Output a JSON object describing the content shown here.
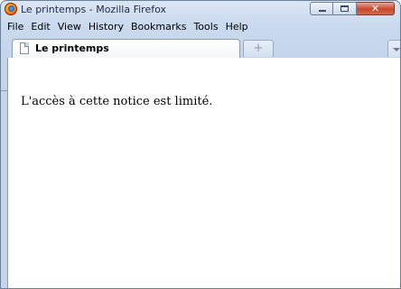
{
  "window": {
    "title": "Le printemps - Mozilla Firefox",
    "close_glyph": "✕"
  },
  "menu": {
    "items": [
      "File",
      "Edit",
      "View",
      "History",
      "Bookmarks",
      "Tools",
      "Help"
    ]
  },
  "tabs": {
    "active_label": "Le printemps",
    "new_tab_glyph": "+"
  },
  "page": {
    "text": "L'accès à cette notice est limité."
  },
  "icons": {
    "app": "firefox-icon",
    "tab": "document-icon",
    "minimize": "minimize-icon",
    "maximize": "maximize-icon",
    "close": "close-icon",
    "new_tab": "plus-icon",
    "tab_list": "chevron-down-icon"
  },
  "colors": {
    "frame": "#c4d5eb",
    "close_button": "#c8482a",
    "content_background": "#ffffff"
  }
}
